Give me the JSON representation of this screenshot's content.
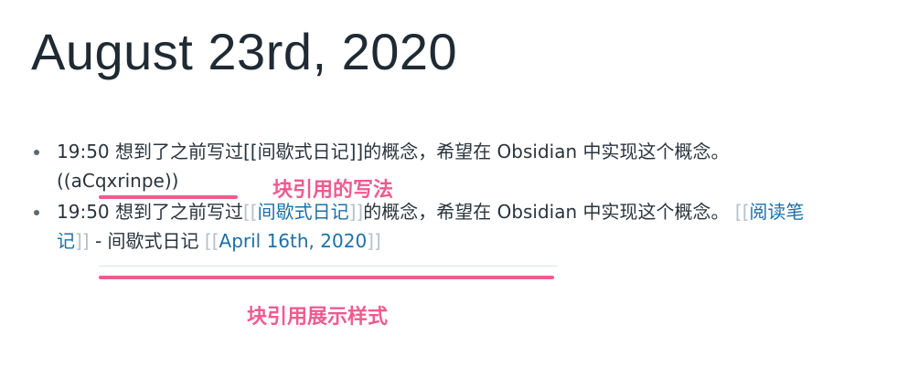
{
  "page": {
    "title": "August 23rd, 2020"
  },
  "blocks": [
    {
      "prefix": "19:50 想到了之前写过[[间歇式日记]]的概念，希望在 Obsidian 中实现这个概念。",
      "block_ref": "((aCqxrinpe))"
    },
    {
      "time_prefix": "19:50 想到了之前写过",
      "link_open": "[[",
      "link_text": "间歇式日记",
      "link_close": "]]",
      "middle": "的概念，希望在 Obsidian 中实现这个概念。",
      "embed": {
        "ref1_open": "[[",
        "ref1_text": "阅读笔记",
        "ref1_close": "]]",
        "sep": " - 间歇式日记 ",
        "ref2_open": "[[",
        "ref2_text": "April 16th, 2020",
        "ref2_close": "]]"
      }
    }
  ],
  "annotations": {
    "block_ref_syntax": "块引用的写法",
    "block_ref_display": "块引用展示样式"
  },
  "colors": {
    "annotation": "#ef5b8d",
    "link": "#1d6fa8",
    "bracket": "#b5c1c9",
    "text": "#2a343c"
  }
}
